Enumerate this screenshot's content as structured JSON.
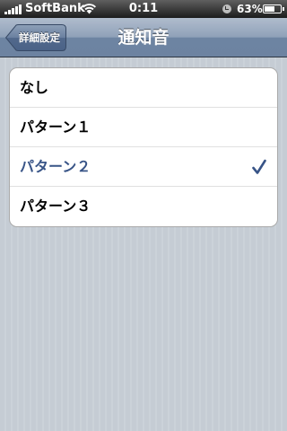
{
  "status_bar": {
    "carrier": "SoftBank",
    "time": "0:11",
    "battery_percent": "63%",
    "battery_level": 0.63,
    "icons": [
      "signal-icon",
      "wifi-icon",
      "orientation-lock-icon",
      "battery-icon"
    ]
  },
  "nav": {
    "back_label": "詳細設定",
    "title": "通知音"
  },
  "list": {
    "items": [
      {
        "label": "なし",
        "selected": false
      },
      {
        "label": "パターン１",
        "selected": false
      },
      {
        "label": "パターン２",
        "selected": true
      },
      {
        "label": "パターン３",
        "selected": false
      }
    ]
  },
  "colors": {
    "selected_text": "#385487",
    "checkmark": "#385487",
    "nav_bar": "#6d84a2",
    "background": "#c5ccd4"
  }
}
